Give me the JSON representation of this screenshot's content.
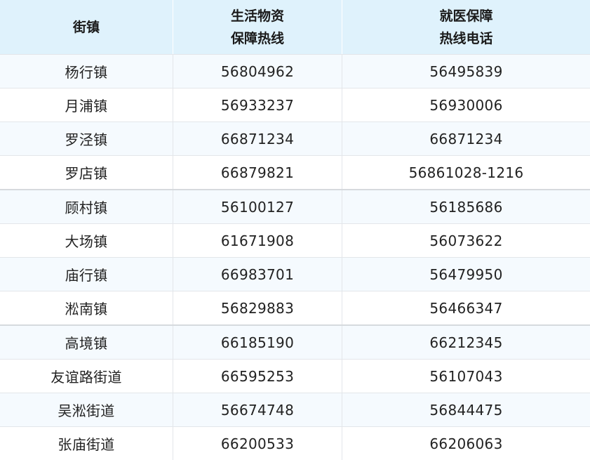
{
  "table": {
    "headers": [
      [
        "街镇"
      ],
      [
        "生活物资",
        "保障热线"
      ],
      [
        "就医保障",
        "热线电话"
      ]
    ],
    "rows": [
      [
        "杨行镇",
        "56804962",
        "56495839"
      ],
      [
        "月浦镇",
        "56933237",
        "56930006"
      ],
      [
        "罗泾镇",
        "66871234",
        "66871234"
      ],
      [
        "罗店镇",
        "66879821",
        "56861028-1216"
      ],
      [
        "顾村镇",
        "56100127",
        "56185686"
      ],
      [
        "大场镇",
        "61671908",
        "56073622"
      ],
      [
        "庙行镇",
        "66983701",
        "56479950"
      ],
      [
        "淞南镇",
        "56829883",
        "56466347"
      ],
      [
        "高境镇",
        "66185190",
        "66212345"
      ],
      [
        "友谊路街道",
        "66595253",
        "56107043"
      ],
      [
        "吴淞街道",
        "56674748",
        "56844475"
      ],
      [
        "张庙街道",
        "66200533",
        "66206063"
      ]
    ]
  }
}
